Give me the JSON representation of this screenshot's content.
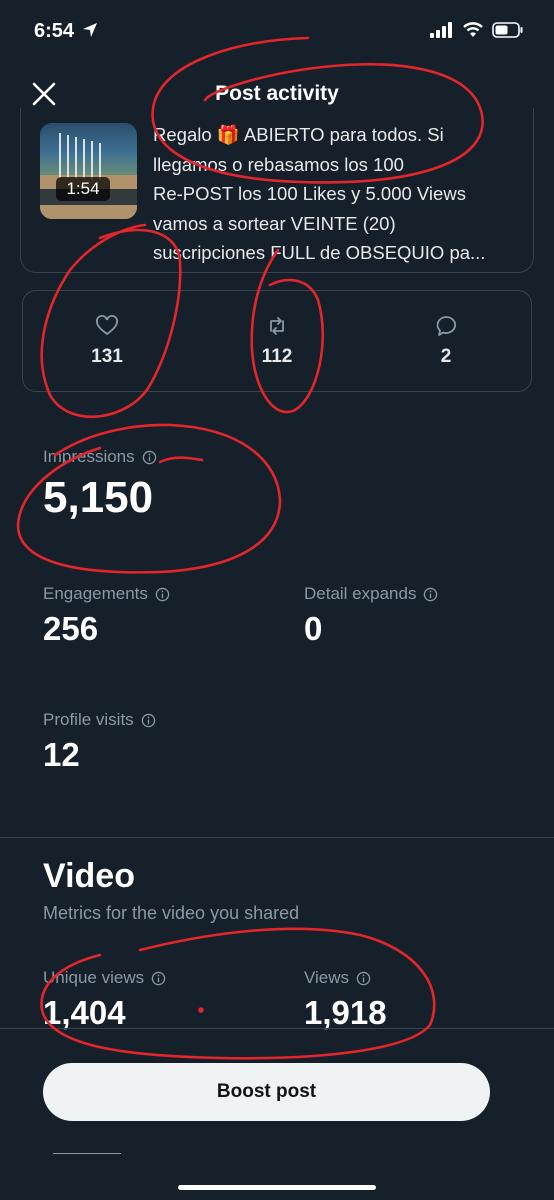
{
  "status_bar": {
    "time": "6:54"
  },
  "header": {
    "title": "Post activity"
  },
  "post": {
    "duration": "1:54",
    "text": "Regalo 🎁 ABIERTO para todos. Si\nllegamos o rebasamos los 100\nRe-POST los 100 Likes y 5.000 Views\nvamos a sortear VEINTE (20)\nsuscripciones FULL de OBSEQUIO pa..."
  },
  "engagement": {
    "likes": "131",
    "reposts": "112",
    "replies": "2"
  },
  "metrics": {
    "impressions": {
      "label": "Impressions",
      "value": "5,150"
    },
    "engagements": {
      "label": "Engagements",
      "value": "256"
    },
    "detail_expands": {
      "label": "Detail expands",
      "value": "0"
    },
    "profile_visits": {
      "label": "Profile visits",
      "value": "12"
    }
  },
  "video": {
    "title": "Video",
    "subtitle": "Metrics for the video you shared",
    "unique_views": {
      "label": "Unique views",
      "value": "1,404"
    },
    "views": {
      "label": "Views",
      "value": "1,918"
    }
  },
  "footer": {
    "boost_label": "Boost post"
  },
  "colors": {
    "background": "#15202b",
    "border": "#38444d",
    "muted": "#8b98a5",
    "annotation": "#e3262b"
  }
}
